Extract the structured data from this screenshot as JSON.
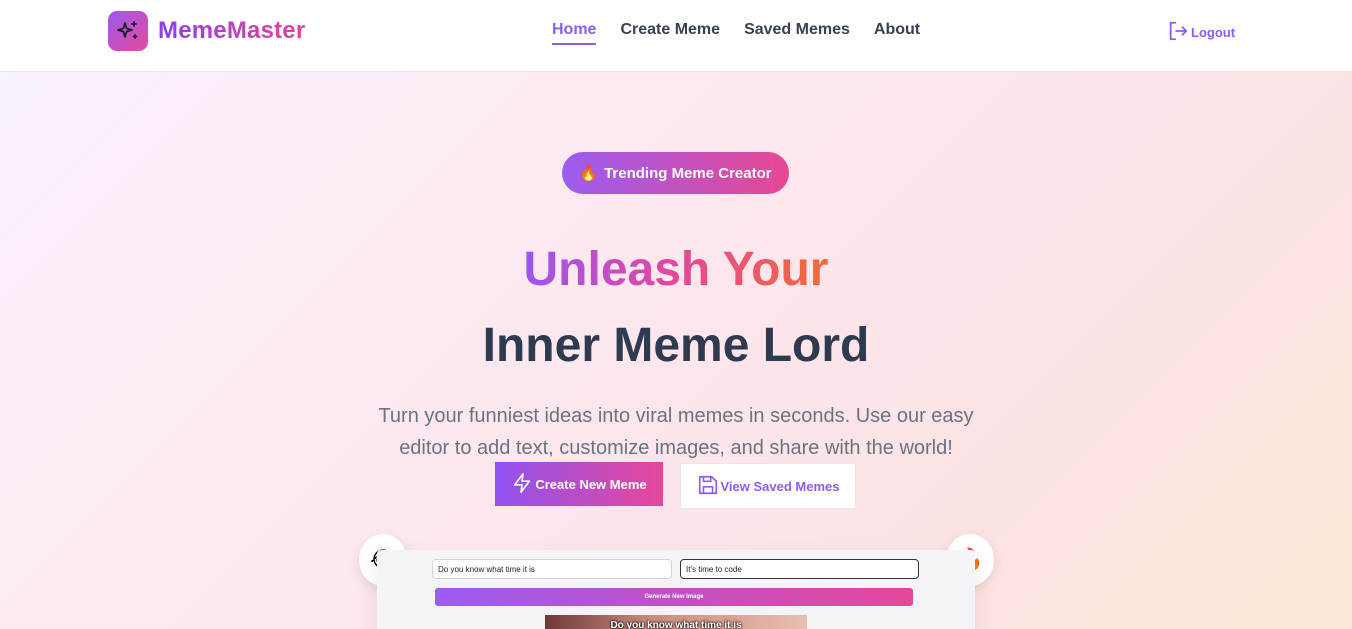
{
  "brand": {
    "name": "MemeMaster",
    "icon": "sparkles-icon"
  },
  "nav": {
    "items": [
      {
        "label": "Home",
        "active": true
      },
      {
        "label": "Create Meme",
        "active": false
      },
      {
        "label": "Saved Memes",
        "active": false
      },
      {
        "label": "About",
        "active": false
      }
    ],
    "logout_label": "Logout",
    "logout_icon": "logout-icon"
  },
  "hero": {
    "badge_emoji": "🔥",
    "badge_label": "Trending Meme Creator",
    "headline_line1": "Unleash Your",
    "headline_line2": "Inner Meme Lord",
    "subtitle": "Turn your funniest ideas into viral memes in seconds. Use our easy editor to add text, customize images, and share with the world!",
    "primary_button": {
      "label": "Create New Meme",
      "icon": "lightning-icon"
    },
    "secondary_button": {
      "label": "View Saved Memes",
      "icon": "save-icon"
    }
  },
  "preview": {
    "left_emoji": "😂",
    "right_emoji": "🔥",
    "top_text_value": "Do you know what time it is",
    "bottom_text_value": "It's time to code",
    "generate_label": "Generate New Image",
    "caption_top": "Do you know what time it is"
  },
  "colors": {
    "accent_purple": "#8b5cf6",
    "accent_pink": "#e6479a",
    "heading_dark": "#2d3a4f"
  }
}
